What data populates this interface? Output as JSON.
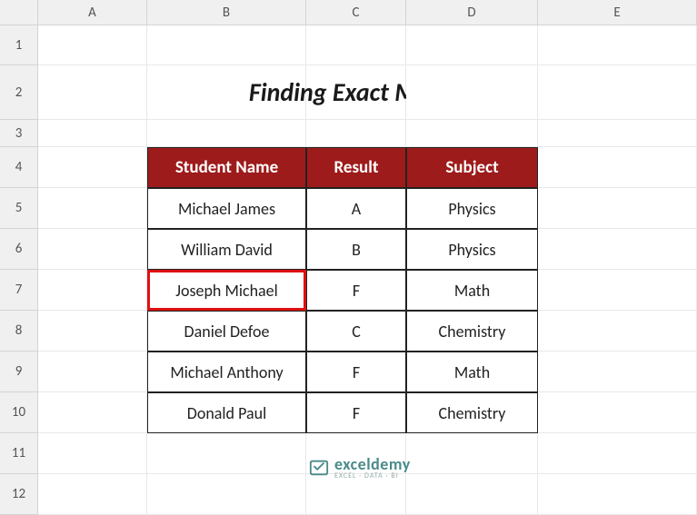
{
  "cols": [
    "A",
    "B",
    "C",
    "D",
    "E"
  ],
  "rows": [
    "1",
    "2",
    "3",
    "4",
    "5",
    "6",
    "7",
    "8",
    "9",
    "10",
    "11",
    "12"
  ],
  "title": "Finding Exact Match",
  "headers": {
    "b": "Student Name",
    "c": "Result",
    "d": "Subject"
  },
  "body": [
    {
      "b": "Michael James",
      "c": "A",
      "d": "Physics"
    },
    {
      "b": "William David",
      "c": "B",
      "d": "Physics"
    },
    {
      "b": "Joseph Michael",
      "c": "F",
      "d": "Math"
    },
    {
      "b": "Daniel Defoe",
      "c": "C",
      "d": "Chemistry"
    },
    {
      "b": "Michael Anthony",
      "c": "F",
      "d": "Math"
    },
    {
      "b": "Donald Paul",
      "c": "F",
      "d": "Chemistry"
    }
  ],
  "highlight_row_index": 2,
  "logo": {
    "name": "exceldemy",
    "sub": "EXCEL · DATA · BI"
  }
}
